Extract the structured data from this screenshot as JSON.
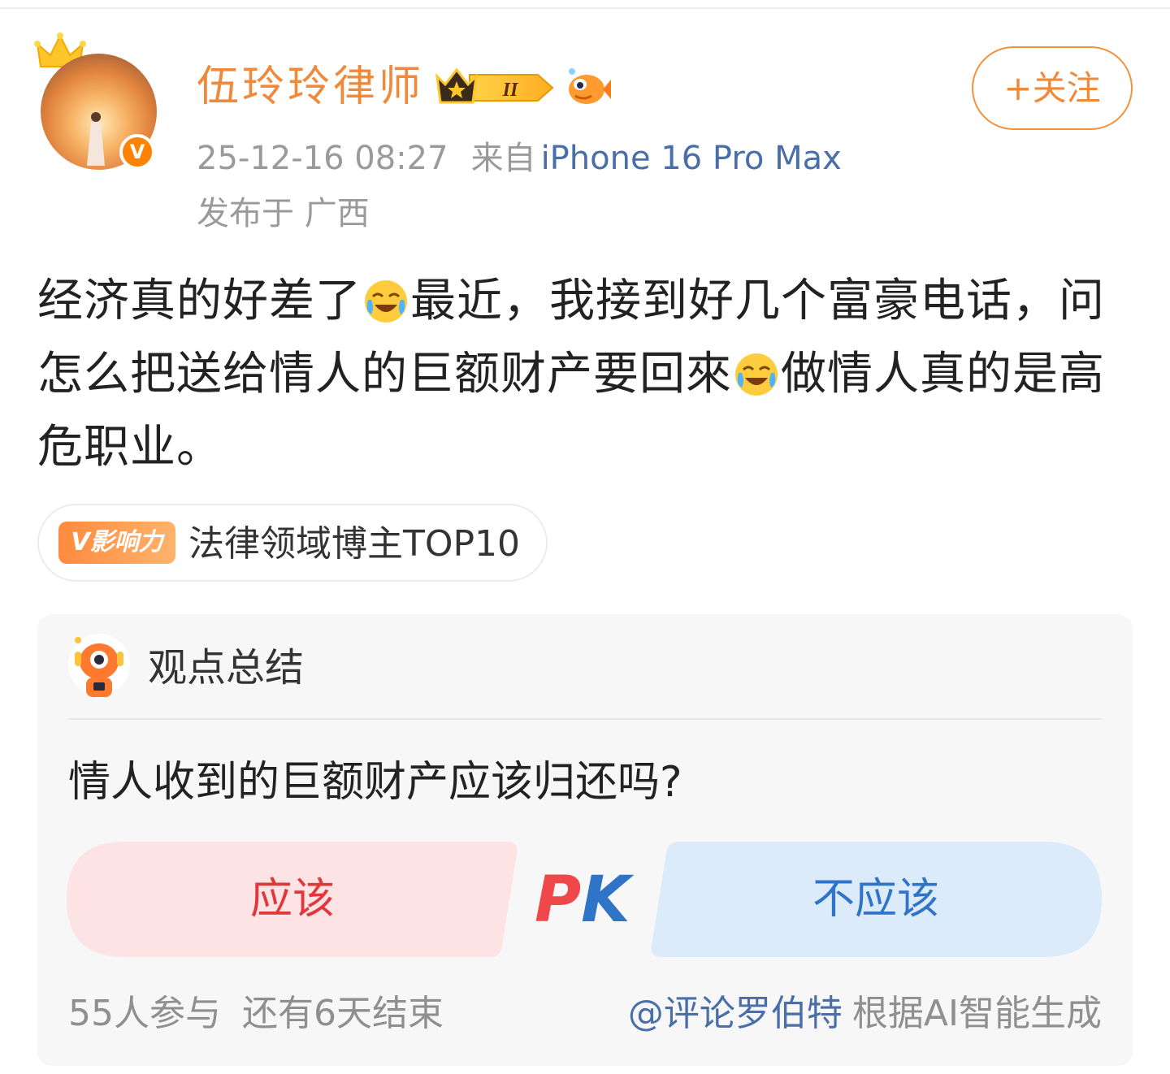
{
  "author": {
    "name": "伍玲玲律师",
    "verified_badge": "V",
    "vip_level": "II"
  },
  "follow_button": "+关注",
  "meta": {
    "time": "25-12-16 08:27",
    "source_prefix": "来自",
    "device": "iPhone 16 Pro Max",
    "location": "发布于 广西"
  },
  "post": {
    "seg1": "经济真的好差了",
    "seg2": "最近，我接到好几个富豪电话，问怎么把送给情人的巨额财产要回來",
    "seg3": "做情人真的是高危职业。"
  },
  "influence": {
    "pill": "V影响力",
    "text": "法律领域博主TOP10"
  },
  "summary_card": {
    "title": "观点总结",
    "question": "情人收到的巨额财产应该归还吗?",
    "option_yes": "应该",
    "pk_left": "P",
    "pk_right": "K",
    "option_no": "不应该",
    "participants": "55人参与",
    "ends_in": "还有6天结束",
    "mention": "@评论罗伯特",
    "generated_by": "根据AI智能生成"
  },
  "colors": {
    "accent_orange": "#f08a3a",
    "link_blue": "#4a6fa8",
    "yes_red": "#e0373a",
    "yes_bg": "#fde3e3",
    "no_blue": "#2f74c6",
    "no_bg": "#dcebfa"
  },
  "icons": [
    "crown-icon",
    "verified-icon",
    "vip-level-icon",
    "fish-icon",
    "laugh-cry-emoji",
    "robot-icon"
  ]
}
